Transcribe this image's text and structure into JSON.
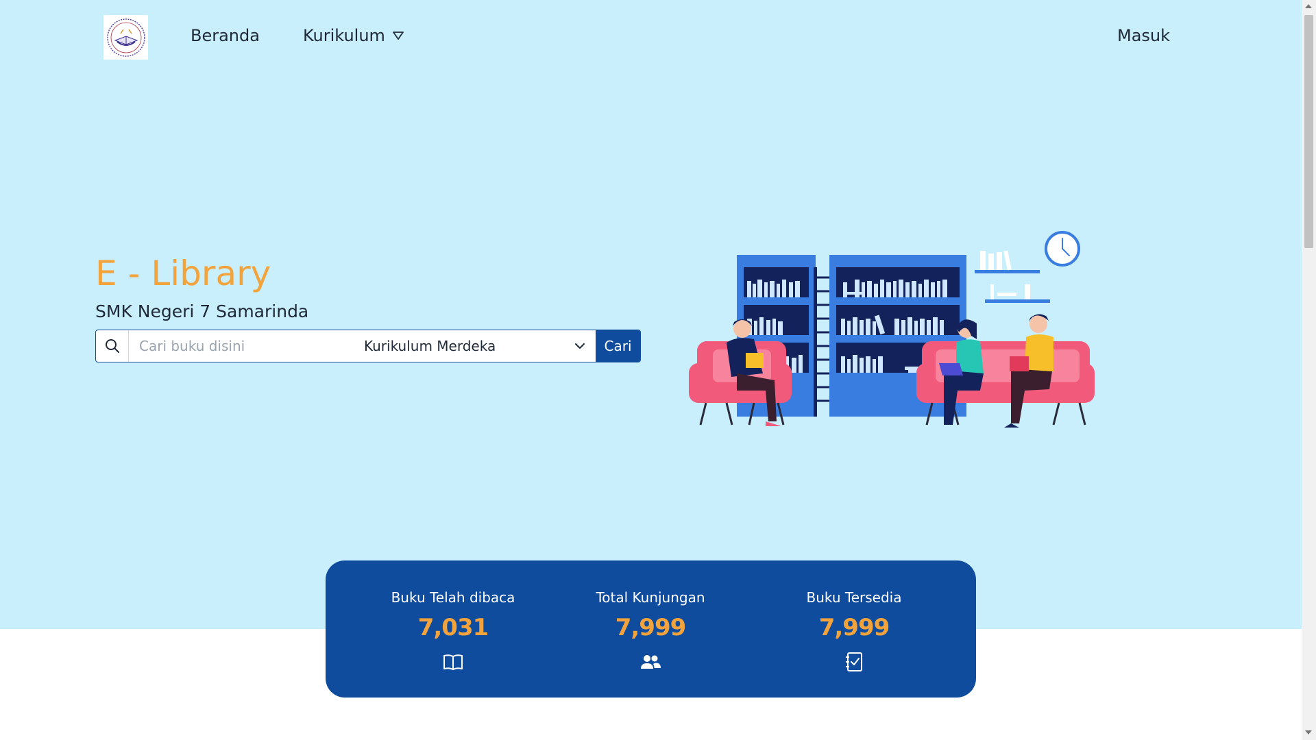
{
  "nav": {
    "home_label": "Beranda",
    "curriculum_label": "Kurikulum",
    "login_label": "Masuk"
  },
  "hero": {
    "title": "E - Library",
    "subtitle": "SMK Negeri 7 Samarinda"
  },
  "search": {
    "placeholder": "Cari buku disini",
    "value": "",
    "curriculum_selected": "Kurikulum Merdeka",
    "button_label": "Cari"
  },
  "stats": [
    {
      "label": "Buku Telah dibaca",
      "value": "7,031",
      "icon": "open-book-icon"
    },
    {
      "label": "Total Kunjungan",
      "value": "7,999",
      "icon": "users-icon"
    },
    {
      "label": "Buku Tersedia",
      "value": "7,999",
      "icon": "checklist-notebook-icon"
    }
  ],
  "colors": {
    "hero_bg": "#c9eefc",
    "accent_orange": "#f3a33b",
    "primary_blue": "#0f4c9e"
  }
}
